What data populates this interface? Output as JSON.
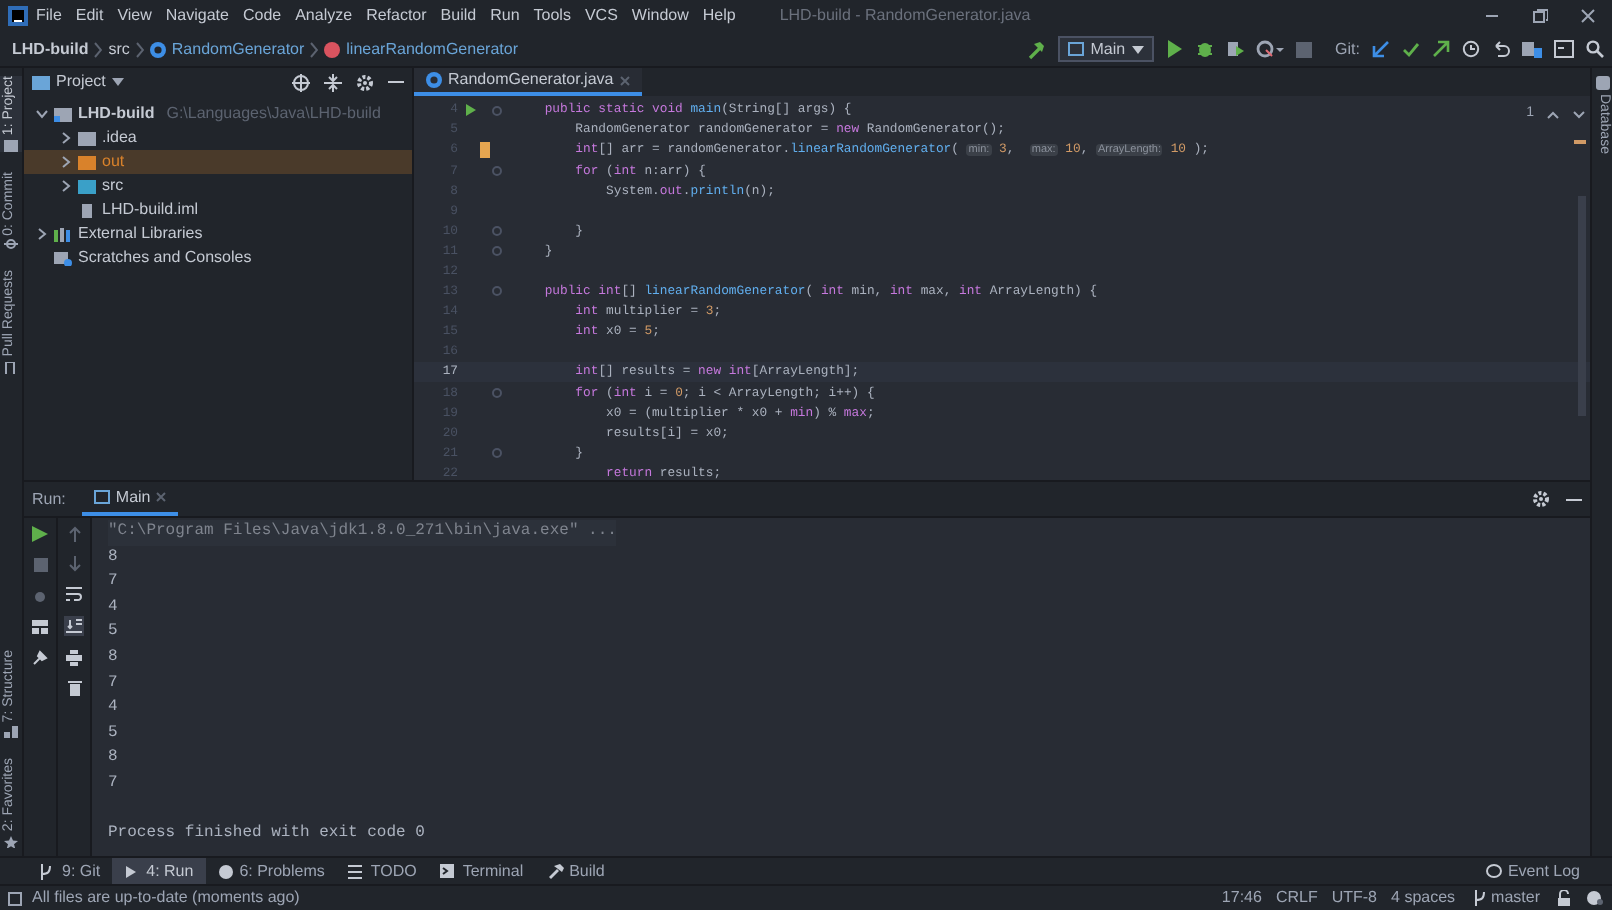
{
  "window": {
    "title": "LHD-build - RandomGenerator.java"
  },
  "menu": [
    "File",
    "Edit",
    "View",
    "Navigate",
    "Code",
    "Analyze",
    "Refactor",
    "Build",
    "Run",
    "Tools",
    "VCS",
    "Window",
    "Help"
  ],
  "breadcrumbs": [
    {
      "label": "LHD-build",
      "kind": "project"
    },
    {
      "label": "src",
      "kind": "folder"
    },
    {
      "label": "RandomGenerator",
      "kind": "class"
    },
    {
      "label": "linearRandomGenerator",
      "kind": "method"
    }
  ],
  "toolbar": {
    "run_config": "Main",
    "git_label": "Git:"
  },
  "left_strip": [
    {
      "label": "1: Project",
      "selected": true
    },
    {
      "label": "0: Commit",
      "selected": false
    },
    {
      "label": "Pull Requests",
      "selected": false
    }
  ],
  "left_strip_bottom": [
    {
      "label": "7: Structure"
    },
    {
      "label": "2: Favorites"
    }
  ],
  "right_strip": [
    {
      "label": "Database"
    }
  ],
  "project_panel": {
    "title": "Project",
    "tree": [
      {
        "label": "LHD-build",
        "path": "G:\\Languages\\Java\\LHD-build",
        "kind": "module",
        "expanded": true,
        "selected": false,
        "children": [
          {
            "label": ".idea",
            "kind": "folder",
            "expanded": false,
            "selected": false
          },
          {
            "label": "out",
            "kind": "excluded",
            "expanded": false,
            "selected": true
          },
          {
            "label": "src",
            "kind": "source",
            "expanded": false,
            "selected": false
          },
          {
            "label": "LHD-build.iml",
            "kind": "file",
            "selected": false
          }
        ]
      },
      {
        "label": "External Libraries",
        "kind": "library",
        "expanded": false,
        "selected": false
      },
      {
        "label": "Scratches and Consoles",
        "kind": "scratch",
        "selected": false
      }
    ]
  },
  "editor": {
    "tabs": [
      {
        "label": "RandomGenerator.java",
        "selected": true
      }
    ],
    "problems": "1",
    "lines": [
      {
        "number": "4",
        "current": false,
        "run": true,
        "changed": false,
        "fold": true,
        "segments": [
          {
            "kind": "kw",
            "text": "    public static void "
          },
          {
            "kind": "fn",
            "text": "main"
          },
          {
            "kind": "txt",
            "text": "(String[] args) {"
          }
        ]
      },
      {
        "number": "5",
        "current": false,
        "run": false,
        "changed": false,
        "fold": false,
        "segments": [
          {
            "kind": "txt",
            "text": "        RandomGenerator randomGenerator = "
          },
          {
            "kind": "kw",
            "text": "new "
          },
          {
            "kind": "txt",
            "text": "RandomGenerator();"
          }
        ]
      },
      {
        "number": "6",
        "current": false,
        "run": false,
        "changed": true,
        "fold": false,
        "segments": [
          {
            "kind": "kw",
            "text": "        int"
          },
          {
            "kind": "txt",
            "text": "[] arr = randomGenerator."
          },
          {
            "kind": "fn",
            "text": "linearRandomGenerator"
          },
          {
            "kind": "txt",
            "text": "( "
          },
          {
            "kind": "hint",
            "text": "min:"
          },
          {
            "kind": "num",
            "text": " 3"
          },
          {
            "kind": "txt",
            "text": ",  "
          },
          {
            "kind": "hint",
            "text": "max:"
          },
          {
            "kind": "num",
            "text": " 10"
          },
          {
            "kind": "txt",
            "text": ", "
          },
          {
            "kind": "hint",
            "text": "ArrayLength:"
          },
          {
            "kind": "num",
            "text": " 10"
          },
          {
            "kind": "txt",
            "text": " );"
          }
        ]
      },
      {
        "number": "7",
        "current": false,
        "run": false,
        "changed": false,
        "fold": true,
        "segments": [
          {
            "kind": "kw",
            "text": "        for "
          },
          {
            "kind": "txt",
            "text": "("
          },
          {
            "kind": "kw",
            "text": "int "
          },
          {
            "kind": "txt",
            "text": "n:arr) {"
          }
        ]
      },
      {
        "number": "8",
        "current": false,
        "run": false,
        "changed": false,
        "fold": false,
        "segments": [
          {
            "kind": "txt",
            "text": "            System."
          },
          {
            "kind": "kw",
            "text": "out"
          },
          {
            "kind": "txt",
            "text": "."
          },
          {
            "kind": "fn",
            "text": "println"
          },
          {
            "kind": "txt",
            "text": "(n);"
          }
        ]
      },
      {
        "number": "9",
        "current": false,
        "run": false,
        "changed": false,
        "fold": false
      },
      {
        "number": "10",
        "current": false,
        "run": false,
        "changed": false,
        "fold": true,
        "segments": [
          {
            "kind": "txt",
            "text": "        }"
          }
        ]
      },
      {
        "number": "11",
        "current": false,
        "run": false,
        "changed": false,
        "fold": true,
        "segments": [
          {
            "kind": "txt",
            "text": "    }"
          }
        ]
      },
      {
        "number": "12",
        "current": false,
        "run": false,
        "changed": false,
        "fold": false
      },
      {
        "number": "13",
        "current": false,
        "run": false,
        "changed": false,
        "fold": true,
        "segments": [
          {
            "kind": "kw",
            "text": "    public int"
          },
          {
            "kind": "txt",
            "text": "[] "
          },
          {
            "kind": "fn",
            "text": "linearRandomGenerator"
          },
          {
            "kind": "txt",
            "text": "( "
          },
          {
            "kind": "kw",
            "text": "int "
          },
          {
            "kind": "txt",
            "text": "min, "
          },
          {
            "kind": "kw",
            "text": "int "
          },
          {
            "kind": "txt",
            "text": "max, "
          },
          {
            "kind": "kw",
            "text": "int "
          },
          {
            "kind": "txt",
            "text": "ArrayLength) {"
          }
        ]
      },
      {
        "number": "14",
        "current": false,
        "run": false,
        "changed": false,
        "fold": false,
        "segments": [
          {
            "kind": "kw",
            "text": "        int "
          },
          {
            "kind": "txt",
            "text": "multiplier = "
          },
          {
            "kind": "num",
            "text": "3"
          },
          {
            "kind": "txt",
            "text": ";"
          }
        ]
      },
      {
        "number": "15",
        "current": false,
        "run": false,
        "changed": false,
        "fold": false,
        "segments": [
          {
            "kind": "kw",
            "text": "        int "
          },
          {
            "kind": "txt",
            "text": "x0 = "
          },
          {
            "kind": "num",
            "text": "5"
          },
          {
            "kind": "txt",
            "text": ";"
          }
        ]
      },
      {
        "number": "16",
        "current": false,
        "run": false,
        "changed": false,
        "fold": false
      },
      {
        "number": "17",
        "current": true,
        "run": false,
        "changed": false,
        "fold": false,
        "segments": [
          {
            "kind": "kw",
            "text": "        int"
          },
          {
            "kind": "txt",
            "text": "[] results = "
          },
          {
            "kind": "kw",
            "text": "new int"
          },
          {
            "kind": "txt",
            "text": "[ArrayLength];"
          }
        ]
      },
      {
        "number": "18",
        "current": false,
        "run": false,
        "changed": false,
        "fold": true,
        "segments": [
          {
            "kind": "kw",
            "text": "        for "
          },
          {
            "kind": "txt",
            "text": "("
          },
          {
            "kind": "kw",
            "text": "int "
          },
          {
            "kind": "txt",
            "text": "i = "
          },
          {
            "kind": "num",
            "text": "0"
          },
          {
            "kind": "txt",
            "text": "; i < ArrayLength; i++) {"
          }
        ]
      },
      {
        "number": "19",
        "current": false,
        "run": false,
        "changed": false,
        "fold": false,
        "segments": [
          {
            "kind": "txt",
            "text": "            x0 = (multiplier * x0 + "
          },
          {
            "kind": "kw",
            "text": "min"
          },
          {
            "kind": "txt",
            "text": ") % "
          },
          {
            "kind": "kw",
            "text": "max"
          },
          {
            "kind": "txt",
            "text": ";"
          }
        ]
      },
      {
        "number": "20",
        "current": false,
        "run": false,
        "changed": false,
        "fold": false,
        "segments": [
          {
            "kind": "txt",
            "text": "            results[i] = x0;"
          }
        ]
      },
      {
        "number": "21",
        "current": false,
        "run": false,
        "changed": false,
        "fold": true,
        "segments": [
          {
            "kind": "txt",
            "text": "        }"
          }
        ]
      },
      {
        "number": "22",
        "current": false,
        "run": false,
        "changed": false,
        "fold": false,
        "segments": [
          {
            "kind": "kw",
            "text": "            return "
          },
          {
            "kind": "txt",
            "text": "results;"
          }
        ]
      }
    ]
  },
  "run_panel": {
    "label": "Run:",
    "tabs": [
      {
        "label": "Main",
        "selected": true
      }
    ],
    "console": [
      {
        "kind": "command",
        "text": "\"C:\\Program Files\\Java\\jdk1.8.0_271\\bin\\java.exe\" ..."
      },
      {
        "kind": "output",
        "text": "8"
      },
      {
        "kind": "output",
        "text": "7"
      },
      {
        "kind": "output",
        "text": "4"
      },
      {
        "kind": "output",
        "text": "5"
      },
      {
        "kind": "output",
        "text": "8"
      },
      {
        "kind": "output",
        "text": "7"
      },
      {
        "kind": "output",
        "text": "4"
      },
      {
        "kind": "output",
        "text": "5"
      },
      {
        "kind": "output",
        "text": "8"
      },
      {
        "kind": "output",
        "text": "7"
      },
      {
        "kind": "blank"
      },
      {
        "kind": "output",
        "text": "Process finished with exit code 0"
      }
    ]
  },
  "tool_tabs": [
    {
      "label": "9: Git",
      "kind": "git",
      "selected": false
    },
    {
      "label": "4: Run",
      "kind": "run",
      "selected": true
    },
    {
      "label": "6: Problems",
      "kind": "problems",
      "selected": false
    },
    {
      "label": "TODO",
      "kind": "todo",
      "selected": false
    },
    {
      "label": "Terminal",
      "kind": "terminal",
      "selected": false
    },
    {
      "label": "Build",
      "kind": "build",
      "selected": false
    }
  ],
  "event_log": "Event Log",
  "status_bar": {
    "message": "All files are up-to-date (moments ago)",
    "items": [
      "17:46",
      "CRLF",
      "UTF-8",
      "4 spaces"
    ],
    "branch": "master"
  }
}
